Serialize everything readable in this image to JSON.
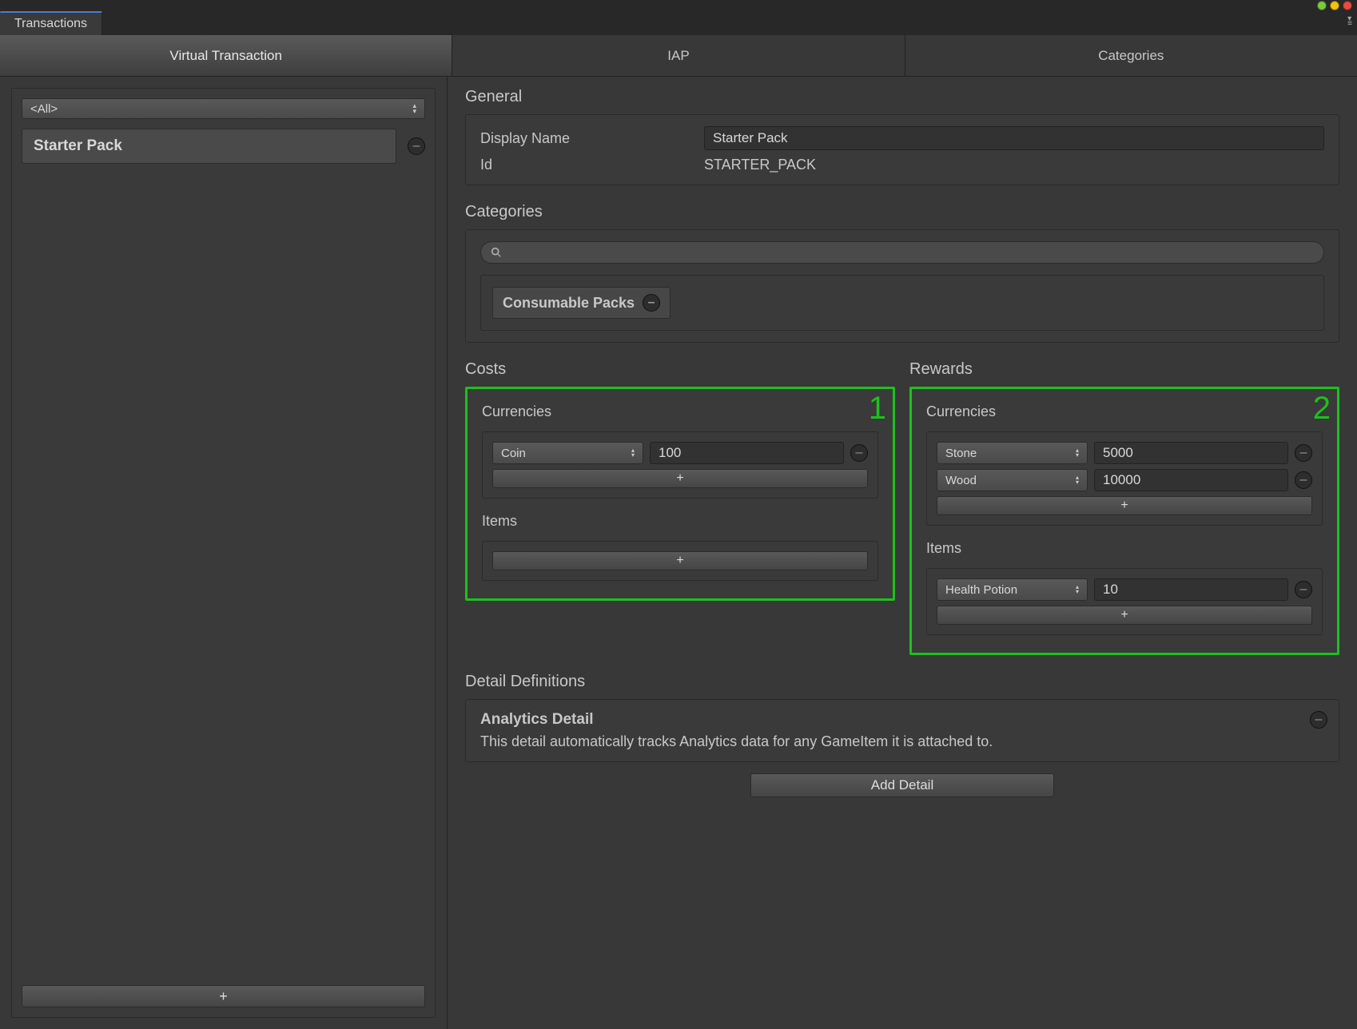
{
  "window": {
    "tab_title": "Transactions"
  },
  "modes": {
    "virtual": "Virtual Transaction",
    "iap": "IAP",
    "categories": "Categories"
  },
  "sidebar": {
    "filter": "<All>",
    "items": [
      {
        "label": "Starter Pack"
      }
    ],
    "add_label": "+"
  },
  "general": {
    "title": "General",
    "display_name_label": "Display Name",
    "display_name_value": "Starter Pack",
    "id_label": "Id",
    "id_value": "STARTER_PACK"
  },
  "categories_section": {
    "title": "Categories",
    "search_placeholder": "",
    "tags": [
      {
        "label": "Consumable Packs"
      }
    ]
  },
  "costs": {
    "title": "Costs",
    "badge": "1",
    "currencies": {
      "title": "Currencies",
      "rows": [
        {
          "name": "Coin",
          "amount": "100"
        }
      ]
    },
    "items": {
      "title": "Items",
      "rows": []
    }
  },
  "rewards": {
    "title": "Rewards",
    "badge": "2",
    "currencies": {
      "title": "Currencies",
      "rows": [
        {
          "name": "Stone",
          "amount": "5000"
        },
        {
          "name": "Wood",
          "amount": "10000"
        }
      ]
    },
    "items": {
      "title": "Items",
      "rows": [
        {
          "name": "Health Potion",
          "amount": "10"
        }
      ]
    }
  },
  "detail_definitions": {
    "title": "Detail Definitions",
    "entries": [
      {
        "title": "Analytics Detail",
        "description": "This detail automatically tracks Analytics data for any GameItem it is attached to."
      }
    ],
    "add_label": "Add Detail"
  },
  "glyphs": {
    "plus": "+",
    "updown": "▴\n▾"
  }
}
